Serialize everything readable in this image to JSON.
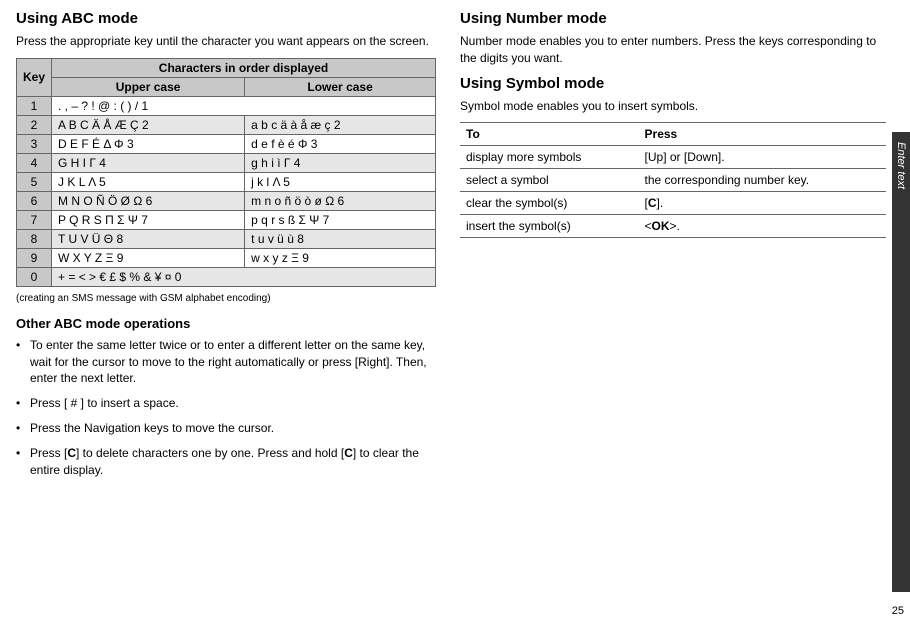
{
  "left": {
    "heading_abc": "Using ABC mode",
    "abc_intro": "Press the appropriate key until the character you want appears on the screen.",
    "table": {
      "key_header": "Key",
      "chars_header": "Characters in order displayed",
      "upper_header": "Upper case",
      "lower_header": "Lower case",
      "rows": [
        {
          "key": "1",
          "upper": ".  ,  –  ?  !  @  :  (  )  /  1",
          "lower": ""
        },
        {
          "key": "2",
          "upper": "A  B  C  Ä  Å  Æ  Ç  2",
          "lower": "a  b  c  ä  à  å  æ  ç  2"
        },
        {
          "key": "3",
          "upper": "D  E  F  É  Δ  Φ  3",
          "lower": "d  e  f  è  é  Φ  3"
        },
        {
          "key": "4",
          "upper": "G  H  I  Γ  4",
          "lower": "g  h  i  ì  Γ  4"
        },
        {
          "key": "5",
          "upper": "J  K  L  Λ  5",
          "lower": "j  k  l  Λ  5"
        },
        {
          "key": "6",
          "upper": "M  N  O  Ñ  Ö  Ø  Ω  6",
          "lower": "m  n  o  ñ  ö  ò  ø  Ω  6"
        },
        {
          "key": "7",
          "upper": "P  Q  R  S  Π  Σ  Ψ  7",
          "lower": "p  q  r  s  ß  Σ  Ψ  7"
        },
        {
          "key": "8",
          "upper": "T  U  V  Ü  Θ  8",
          "lower": "t  u  v  ü  ù  8"
        },
        {
          "key": "9",
          "upper": "W  X  Y  Z  Ξ  9",
          "lower": "w  x  y  z  Ξ  9"
        },
        {
          "key": "0",
          "upper": "+  =  <  >  €  £  $  %  &  ¥  ¤  0",
          "lower": ""
        }
      ]
    },
    "caption": "(creating an SMS message with GSM alphabet encoding)",
    "other_heading": "Other ABC mode operations",
    "bullets": [
      "To enter the same letter twice or to enter a different letter on the same key, wait for the cursor to move to the right automatically or press [Right]. Then, enter the next letter.",
      "Press [ # ] to insert a space.",
      "Press the Navigation keys to move the cursor.",
      "Press [C] to delete characters one by one. Press and hold [C] to clear the entire display."
    ]
  },
  "right": {
    "heading_number": "Using Number mode",
    "number_text": "Number mode enables you to enter numbers. Press the keys corresponding to the digits you want.",
    "heading_symbol": "Using Symbol mode",
    "symbol_text": "Symbol mode enables you to insert symbols.",
    "press_table": {
      "to_header": "To",
      "press_header": "Press",
      "rows": [
        {
          "to": "display more symbols",
          "press": "[Up] or [Down]."
        },
        {
          "to": "select a symbol",
          "press": "the corresponding number key."
        },
        {
          "to": "clear the symbol(s)",
          "press": "[C]."
        },
        {
          "to": "insert the symbol(s)",
          "press": "<OK>."
        }
      ]
    }
  },
  "side_tab": "Enter text",
  "page_num": "25"
}
